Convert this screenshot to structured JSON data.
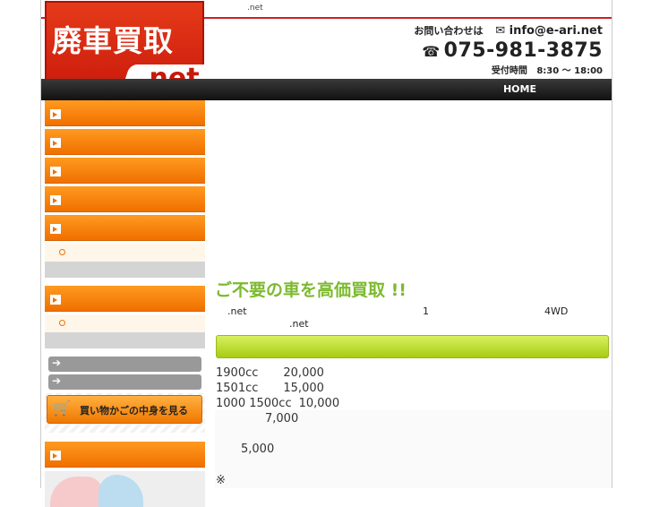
{
  "header": {
    "top_domain": ".net",
    "logo_title": "廃車買取",
    "logo_sub": ".net",
    "contact_label": "お問い合わせは",
    "mail_icon": "envelope-icon",
    "email": "info@e-ari.net",
    "phone_icon": "telephone-icon",
    "phone": "075-981-3875",
    "hours_label": "受付時間",
    "hours": "8:30 〜 18:00"
  },
  "nav": {
    "home": "HOME"
  },
  "sidebar": {
    "items_count_note": "",
    "cart_label": "買い物かごの中身を見る",
    "cart_icon": "cart-icon",
    "arrow_icon": "arrow-right-icon"
  },
  "main": {
    "headline": "ご不要の車を高価買取 !!",
    "intro_a": ".net",
    "intro_b": "1",
    "intro_c": "4WD",
    "intro_d": ".net",
    "prices": [
      {
        "cc": "1900cc",
        "value": "20,000"
      },
      {
        "cc": "1501cc",
        "value": "15,000"
      },
      {
        "cc": "1000 1500cc",
        "value": "10,000"
      }
    ],
    "price_7000": "7,000",
    "price_5000": "5,000",
    "note_mark": "※"
  }
}
